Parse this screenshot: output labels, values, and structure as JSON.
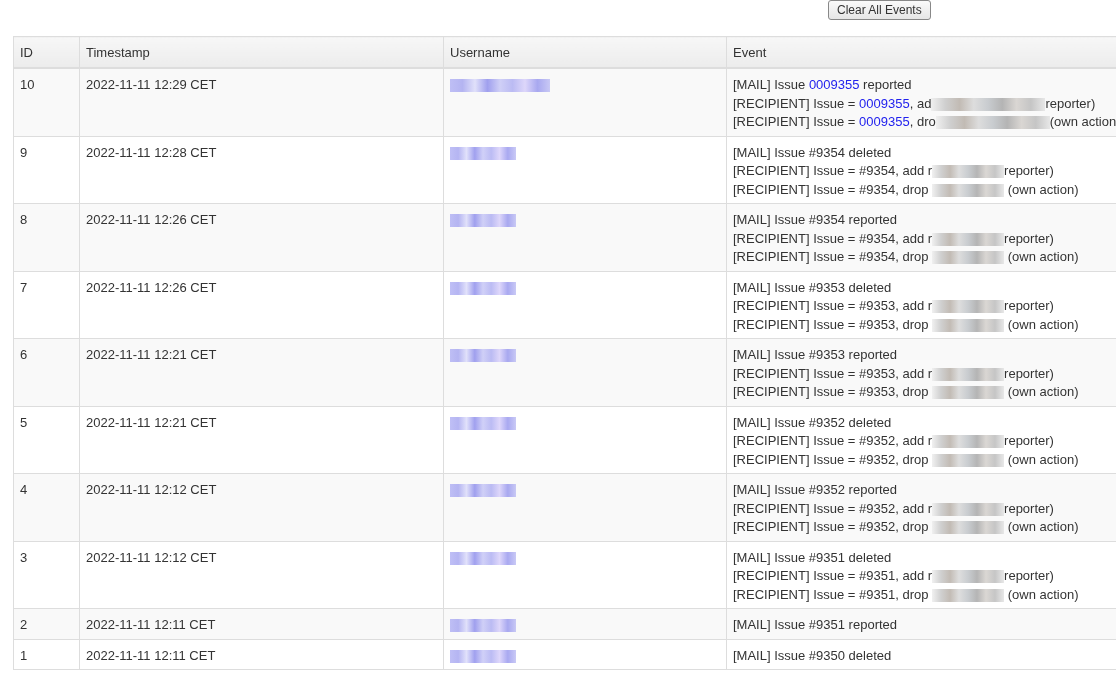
{
  "toolbar": {
    "button": "Clear All Events"
  },
  "table": {
    "columns": [
      "ID",
      "Timestamp",
      "Username",
      "Event"
    ],
    "rows": [
      {
        "id": "10",
        "timestamp": "2022-11-11 12:29 CET",
        "username": [
          {
            "kind": "redacted-link"
          }
        ],
        "event": [
          [
            {
              "kind": "text",
              "text": "[MAIL] Issue "
            },
            {
              "kind": "link",
              "text": "0009355"
            },
            {
              "kind": "text",
              "text": " reported"
            }
          ],
          [
            {
              "kind": "text",
              "text": "[RECIPIENT] Issue = "
            },
            {
              "kind": "link",
              "text": "0009355"
            },
            {
              "kind": "text",
              "text": ", ad"
            },
            {
              "kind": "redacted"
            },
            {
              "kind": "text",
              "text": "reporter)"
            }
          ],
          [
            {
              "kind": "text",
              "text": "[RECIPIENT] Issue = "
            },
            {
              "kind": "link",
              "text": "0009355"
            },
            {
              "kind": "text",
              "text": ", dro"
            },
            {
              "kind": "redacted"
            },
            {
              "kind": "text",
              "text": "(own action"
            }
          ]
        ]
      },
      {
        "id": "9",
        "timestamp": "2022-11-11 12:28 CET",
        "username": [
          {
            "kind": "redacted-link"
          }
        ],
        "event": [
          [
            {
              "kind": "text",
              "text": "[MAIL] Issue #9354 deleted"
            }
          ],
          [
            {
              "kind": "text",
              "text": "[RECIPIENT] Issue = #9354, add r"
            },
            {
              "kind": "redacted"
            },
            {
              "kind": "text",
              "text": "reporter)"
            }
          ],
          [
            {
              "kind": "text",
              "text": "[RECIPIENT] Issue = #9354, drop "
            },
            {
              "kind": "redacted"
            },
            {
              "kind": "text",
              "text": " (own action)"
            }
          ]
        ]
      },
      {
        "id": "8",
        "timestamp": "2022-11-11 12:26 CET",
        "username": [
          {
            "kind": "redacted-link"
          }
        ],
        "event": [
          [
            {
              "kind": "text",
              "text": "[MAIL] Issue #9354 reported"
            }
          ],
          [
            {
              "kind": "text",
              "text": "[RECIPIENT] Issue = #9354, add r"
            },
            {
              "kind": "redacted"
            },
            {
              "kind": "text",
              "text": "reporter)"
            }
          ],
          [
            {
              "kind": "text",
              "text": "[RECIPIENT] Issue = #9354, drop "
            },
            {
              "kind": "redacted"
            },
            {
              "kind": "text",
              "text": " (own action)"
            }
          ]
        ]
      },
      {
        "id": "7",
        "timestamp": "2022-11-11 12:26 CET",
        "username": [
          {
            "kind": "redacted-link"
          }
        ],
        "event": [
          [
            {
              "kind": "text",
              "text": "[MAIL] Issue #9353 deleted"
            }
          ],
          [
            {
              "kind": "text",
              "text": "[RECIPIENT] Issue = #9353, add r"
            },
            {
              "kind": "redacted"
            },
            {
              "kind": "text",
              "text": "reporter)"
            }
          ],
          [
            {
              "kind": "text",
              "text": "[RECIPIENT] Issue = #9353, drop "
            },
            {
              "kind": "redacted"
            },
            {
              "kind": "text",
              "text": " (own action)"
            }
          ]
        ]
      },
      {
        "id": "6",
        "timestamp": "2022-11-11 12:21 CET",
        "username": [
          {
            "kind": "redacted-link"
          }
        ],
        "event": [
          [
            {
              "kind": "text",
              "text": "[MAIL] Issue #9353 reported"
            }
          ],
          [
            {
              "kind": "text",
              "text": "[RECIPIENT] Issue = #9353, add r"
            },
            {
              "kind": "redacted"
            },
            {
              "kind": "text",
              "text": "reporter)"
            }
          ],
          [
            {
              "kind": "text",
              "text": "[RECIPIENT] Issue = #9353, drop "
            },
            {
              "kind": "redacted"
            },
            {
              "kind": "text",
              "text": " (own action)"
            }
          ]
        ]
      },
      {
        "id": "5",
        "timestamp": "2022-11-11 12:21 CET",
        "username": [
          {
            "kind": "redacted-link"
          }
        ],
        "event": [
          [
            {
              "kind": "text",
              "text": "[MAIL] Issue #9352 deleted"
            }
          ],
          [
            {
              "kind": "text",
              "text": "[RECIPIENT] Issue = #9352, add r"
            },
            {
              "kind": "redacted"
            },
            {
              "kind": "text",
              "text": "reporter)"
            }
          ],
          [
            {
              "kind": "text",
              "text": "[RECIPIENT] Issue = #9352, drop "
            },
            {
              "kind": "redacted"
            },
            {
              "kind": "text",
              "text": " (own action)"
            }
          ]
        ]
      },
      {
        "id": "4",
        "timestamp": "2022-11-11 12:12 CET",
        "username": [
          {
            "kind": "redacted-link"
          }
        ],
        "event": [
          [
            {
              "kind": "text",
              "text": "[MAIL] Issue #9352 reported"
            }
          ],
          [
            {
              "kind": "text",
              "text": "[RECIPIENT] Issue = #9352, add r"
            },
            {
              "kind": "redacted"
            },
            {
              "kind": "text",
              "text": "reporter)"
            }
          ],
          [
            {
              "kind": "text",
              "text": "[RECIPIENT] Issue = #9352, drop "
            },
            {
              "kind": "redacted"
            },
            {
              "kind": "text",
              "text": " (own action)"
            }
          ]
        ]
      },
      {
        "id": "3",
        "timestamp": "2022-11-11 12:12 CET",
        "username": [
          {
            "kind": "redacted-link"
          }
        ],
        "event": [
          [
            {
              "kind": "text",
              "text": "[MAIL] Issue #9351 deleted"
            }
          ],
          [
            {
              "kind": "text",
              "text": "[RECIPIENT] Issue = #9351, add r"
            },
            {
              "kind": "redacted"
            },
            {
              "kind": "text",
              "text": "reporter)"
            }
          ],
          [
            {
              "kind": "text",
              "text": "[RECIPIENT] Issue = #9351, drop "
            },
            {
              "kind": "redacted"
            },
            {
              "kind": "text",
              "text": " (own action)"
            }
          ]
        ]
      },
      {
        "id": "2",
        "timestamp": "2022-11-11 12:11 CET",
        "username": [
          {
            "kind": "redacted-link"
          }
        ],
        "event": [
          [
            {
              "kind": "text",
              "text": "[MAIL] Issue #9351 reported"
            }
          ]
        ]
      },
      {
        "id": "1",
        "timestamp": "2022-11-11 12:11 CET",
        "username": [
          {
            "kind": "redacted-link"
          }
        ],
        "event": [
          [
            {
              "kind": "text",
              "text": "[MAIL] Issue #9350 deleted"
            }
          ]
        ]
      }
    ]
  }
}
